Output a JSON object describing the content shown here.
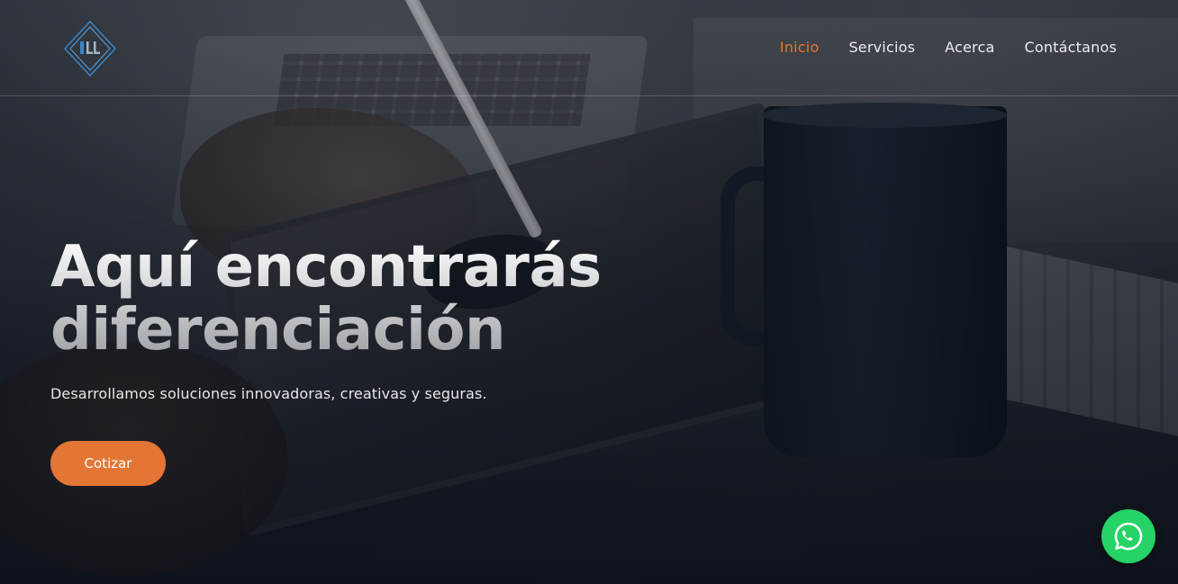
{
  "logo": {
    "initials": "LL",
    "accent_color": "#3a86c8"
  },
  "nav": {
    "items": [
      {
        "label": "Inicio",
        "active": true
      },
      {
        "label": "Servicios",
        "active": false
      },
      {
        "label": "Acerca",
        "active": false
      },
      {
        "label": "Contáctanos",
        "active": false
      }
    ],
    "active_color": "#e8742f"
  },
  "hero": {
    "title_line1": "Aquí encontrarás",
    "title_line2": "diferenciación",
    "subtitle": "Desarrollamos soluciones innovadoras, creativas y seguras.",
    "cta_label": "Cotizar",
    "cta_color": "#e37634"
  },
  "whatsapp": {
    "icon": "whatsapp-icon",
    "color": "#25d366"
  }
}
